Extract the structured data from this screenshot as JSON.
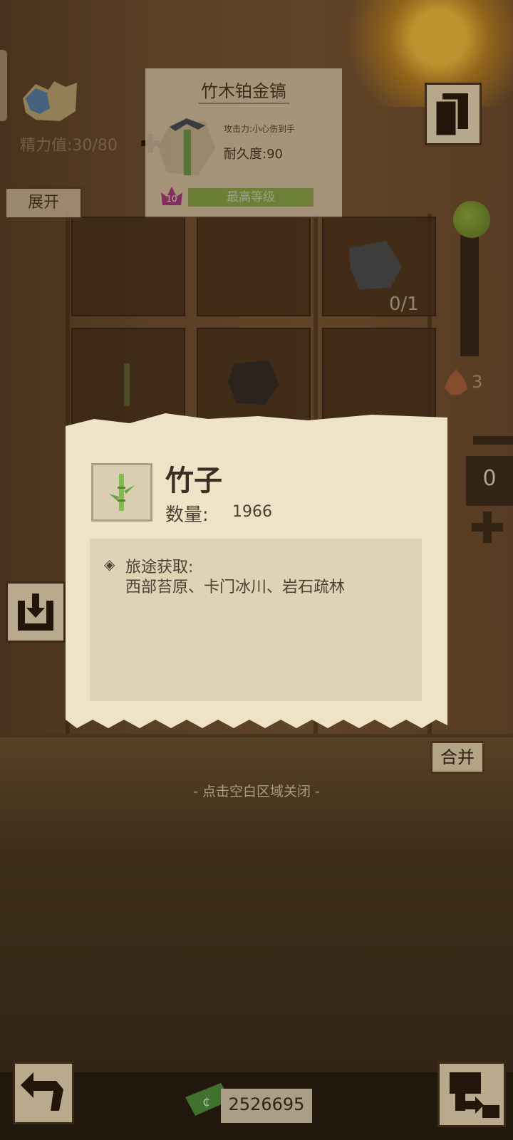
{
  "energy": {
    "label": "精力值:30/80"
  },
  "sidebar": {
    "expand_label": "展开"
  },
  "tool_card": {
    "name": "竹木铂金镐",
    "attack": "攻击力:小心伤到手",
    "durability": "耐久度:90",
    "level": "10",
    "max_level": "最高等级"
  },
  "inventory": {
    "slot_progress": "0/1",
    "fire_count": "3"
  },
  "quantity": {
    "value": "0"
  },
  "popup": {
    "title": "竹子",
    "quantity_label": "数量:",
    "quantity_value": "1966",
    "source_label": "旅途获取:",
    "source_places": "西部苔原、卡门冰川、岩石疏林"
  },
  "merge_label": "合并",
  "close_hint": "- 点击空白区域关闭 -",
  "currency": {
    "amount": "2526695"
  },
  "colors": {
    "paper": "#efe3c7",
    "wood": "#6e4d2d",
    "accent_green": "#8ab44a",
    "crown": "#b4338a"
  },
  "icons": [
    "energy-icon",
    "plus-icon",
    "pickaxe-icon",
    "crown-icon",
    "cards-icon",
    "rock-icon",
    "fire-icon",
    "bamboo-icon",
    "import-icon",
    "back-icon",
    "money-icon",
    "shop-icon"
  ]
}
